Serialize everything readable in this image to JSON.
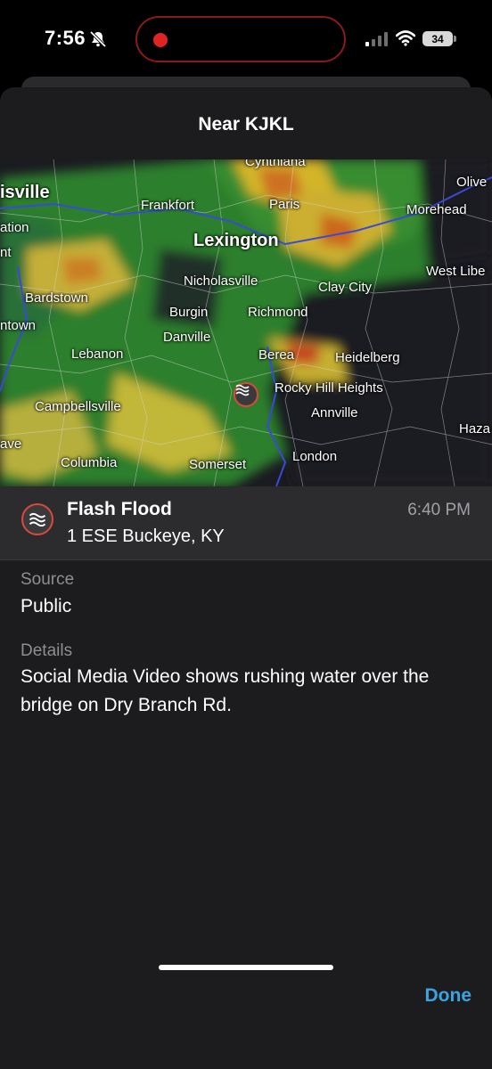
{
  "status_bar": {
    "time": "7:56",
    "battery_level": "34",
    "icons": [
      "bell-slash-icon",
      "signal-icon",
      "wifi-icon",
      "battery-icon"
    ]
  },
  "sheet": {
    "title": "Near KJKL"
  },
  "map": {
    "labels": {
      "cynthiana": "Cynthiana",
      "louisville": "isville",
      "frankfort": "Frankfort",
      "paris": "Paris",
      "olive": "Olive",
      "morehead": "Morehead",
      "station": "ation",
      "nt": "nt",
      "lexington": "Lexington",
      "west_liberty": "West Libe",
      "nicholasville": "Nicholasville",
      "clay_city": "Clay City",
      "bardstown": "Bardstown",
      "burgin": "Burgin",
      "richmond": "Richmond",
      "town": "ntown",
      "danville": "Danville",
      "lebanon": "Lebanon",
      "berea": "Berea",
      "heidelberg": "Heidelberg",
      "rocky_hill": "Rocky Hill Heights",
      "campbellsville": "Campbellsville",
      "annville": "Annville",
      "hazard": "Haza",
      "ave": "ave",
      "columbia": "Columbia",
      "somerset": "Somerset",
      "london": "London"
    },
    "marker_icon": "flood-waves-icon"
  },
  "event": {
    "icon": "flood-waves-icon",
    "title": "Flash Flood",
    "location": "1 ESE Buckeye, KY",
    "time": "6:40 PM"
  },
  "source": {
    "label": "Source",
    "value": "Public"
  },
  "details": {
    "label": "Details",
    "value": "Social Media Video shows rushing water over the bridge on Dry Branch Rd."
  },
  "done_label": "Done",
  "colors": {
    "accent": "#3aa3e0",
    "marker_border": "#d84a3a",
    "sheet_bg": "#1c1c1e"
  }
}
